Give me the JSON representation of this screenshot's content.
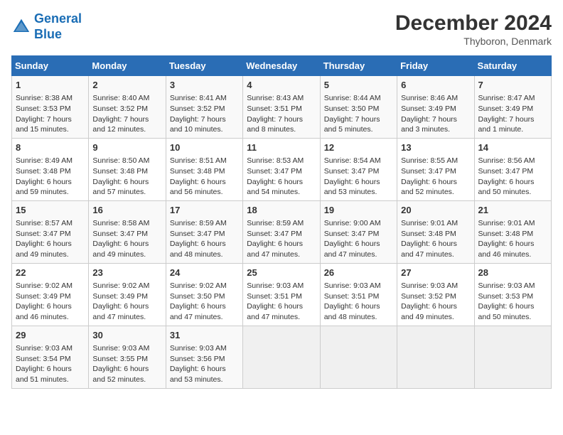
{
  "logo": {
    "line1": "General",
    "line2": "Blue"
  },
  "title": "December 2024",
  "location": "Thyboron, Denmark",
  "days_of_week": [
    "Sunday",
    "Monday",
    "Tuesday",
    "Wednesday",
    "Thursday",
    "Friday",
    "Saturday"
  ],
  "weeks": [
    [
      {
        "day": "1",
        "sunrise": "8:38 AM",
        "sunset": "3:53 PM",
        "daylight": "7 hours and 15 minutes."
      },
      {
        "day": "2",
        "sunrise": "8:40 AM",
        "sunset": "3:52 PM",
        "daylight": "7 hours and 12 minutes."
      },
      {
        "day": "3",
        "sunrise": "8:41 AM",
        "sunset": "3:52 PM",
        "daylight": "7 hours and 10 minutes."
      },
      {
        "day": "4",
        "sunrise": "8:43 AM",
        "sunset": "3:51 PM",
        "daylight": "7 hours and 8 minutes."
      },
      {
        "day": "5",
        "sunrise": "8:44 AM",
        "sunset": "3:50 PM",
        "daylight": "7 hours and 5 minutes."
      },
      {
        "day": "6",
        "sunrise": "8:46 AM",
        "sunset": "3:49 PM",
        "daylight": "7 hours and 3 minutes."
      },
      {
        "day": "7",
        "sunrise": "8:47 AM",
        "sunset": "3:49 PM",
        "daylight": "7 hours and 1 minute."
      }
    ],
    [
      {
        "day": "8",
        "sunrise": "8:49 AM",
        "sunset": "3:48 PM",
        "daylight": "6 hours and 59 minutes."
      },
      {
        "day": "9",
        "sunrise": "8:50 AM",
        "sunset": "3:48 PM",
        "daylight": "6 hours and 57 minutes."
      },
      {
        "day": "10",
        "sunrise": "8:51 AM",
        "sunset": "3:48 PM",
        "daylight": "6 hours and 56 minutes."
      },
      {
        "day": "11",
        "sunrise": "8:53 AM",
        "sunset": "3:47 PM",
        "daylight": "6 hours and 54 minutes."
      },
      {
        "day": "12",
        "sunrise": "8:54 AM",
        "sunset": "3:47 PM",
        "daylight": "6 hours and 53 minutes."
      },
      {
        "day": "13",
        "sunrise": "8:55 AM",
        "sunset": "3:47 PM",
        "daylight": "6 hours and 52 minutes."
      },
      {
        "day": "14",
        "sunrise": "8:56 AM",
        "sunset": "3:47 PM",
        "daylight": "6 hours and 50 minutes."
      }
    ],
    [
      {
        "day": "15",
        "sunrise": "8:57 AM",
        "sunset": "3:47 PM",
        "daylight": "6 hours and 49 minutes."
      },
      {
        "day": "16",
        "sunrise": "8:58 AM",
        "sunset": "3:47 PM",
        "daylight": "6 hours and 49 minutes."
      },
      {
        "day": "17",
        "sunrise": "8:59 AM",
        "sunset": "3:47 PM",
        "daylight": "6 hours and 48 minutes."
      },
      {
        "day": "18",
        "sunrise": "8:59 AM",
        "sunset": "3:47 PM",
        "daylight": "6 hours and 47 minutes."
      },
      {
        "day": "19",
        "sunrise": "9:00 AM",
        "sunset": "3:47 PM",
        "daylight": "6 hours and 47 minutes."
      },
      {
        "day": "20",
        "sunrise": "9:01 AM",
        "sunset": "3:48 PM",
        "daylight": "6 hours and 47 minutes."
      },
      {
        "day": "21",
        "sunrise": "9:01 AM",
        "sunset": "3:48 PM",
        "daylight": "6 hours and 46 minutes."
      }
    ],
    [
      {
        "day": "22",
        "sunrise": "9:02 AM",
        "sunset": "3:49 PM",
        "daylight": "6 hours and 46 minutes."
      },
      {
        "day": "23",
        "sunrise": "9:02 AM",
        "sunset": "3:49 PM",
        "daylight": "6 hours and 47 minutes."
      },
      {
        "day": "24",
        "sunrise": "9:02 AM",
        "sunset": "3:50 PM",
        "daylight": "6 hours and 47 minutes."
      },
      {
        "day": "25",
        "sunrise": "9:03 AM",
        "sunset": "3:51 PM",
        "daylight": "6 hours and 47 minutes."
      },
      {
        "day": "26",
        "sunrise": "9:03 AM",
        "sunset": "3:51 PM",
        "daylight": "6 hours and 48 minutes."
      },
      {
        "day": "27",
        "sunrise": "9:03 AM",
        "sunset": "3:52 PM",
        "daylight": "6 hours and 49 minutes."
      },
      {
        "day": "28",
        "sunrise": "9:03 AM",
        "sunset": "3:53 PM",
        "daylight": "6 hours and 50 minutes."
      }
    ],
    [
      {
        "day": "29",
        "sunrise": "9:03 AM",
        "sunset": "3:54 PM",
        "daylight": "6 hours and 51 minutes."
      },
      {
        "day": "30",
        "sunrise": "9:03 AM",
        "sunset": "3:55 PM",
        "daylight": "6 hours and 52 minutes."
      },
      {
        "day": "31",
        "sunrise": "9:03 AM",
        "sunset": "3:56 PM",
        "daylight": "6 hours and 53 minutes."
      },
      null,
      null,
      null,
      null
    ]
  ]
}
